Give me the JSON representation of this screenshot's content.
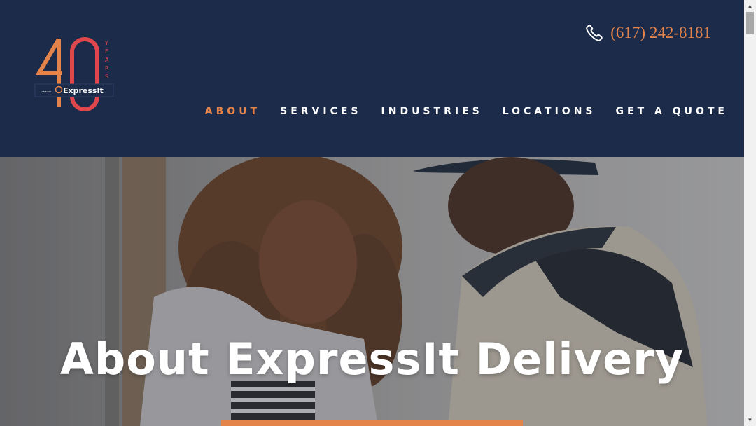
{
  "brand": {
    "logo_number": "40",
    "logo_years": "YEARS",
    "logo_name": "ExpressIt",
    "logo_tagline": "SAME DAY DELIVERY"
  },
  "header": {
    "phone": "(617) 242-8181",
    "nav": [
      {
        "label": "ABOUT",
        "active": true
      },
      {
        "label": "SERVICES",
        "active": false
      },
      {
        "label": "INDUSTRIES",
        "active": false
      },
      {
        "label": "LOCATIONS",
        "active": false
      },
      {
        "label": "GET A QUOTE",
        "active": false
      }
    ]
  },
  "hero": {
    "title": "About ExpressIt Delivery"
  },
  "colors": {
    "header_bg": "#1c2b4a",
    "accent": "#e5844a",
    "logo_red": "#e0474c",
    "nav_text": "#ffffff"
  },
  "icons": {
    "phone": "phone-icon"
  }
}
